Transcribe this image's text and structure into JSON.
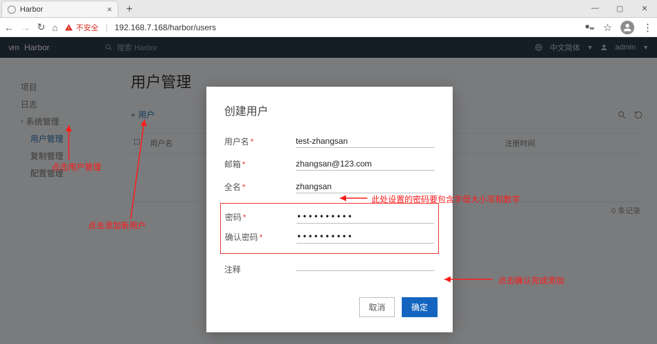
{
  "browser": {
    "tab_title": "Harbor",
    "ssl_warning": "不安全",
    "url": "192.168.7.168/harbor/users"
  },
  "harbor_header": {
    "vm_logo": "vm",
    "product": "Harbor",
    "search_placeholder": "搜索 Harbor",
    "lang": "中文简体",
    "user": "admin"
  },
  "sidebar": {
    "items": [
      {
        "label": "项目"
      },
      {
        "label": "日志"
      }
    ],
    "group_label": "系统管理",
    "sub_items": [
      {
        "label": "用户管理",
        "active": true
      },
      {
        "label": "复制管理"
      },
      {
        "label": "配置管理"
      }
    ]
  },
  "main": {
    "title": "用户管理",
    "add_button": "用户",
    "columns": {
      "c1": "用户名",
      "c2": "注册时间"
    },
    "footer": "0 条记录"
  },
  "modal": {
    "title": "创建用户",
    "labels": {
      "username": "用户名",
      "email": "邮箱",
      "fullname": "全名",
      "password": "密码",
      "confirm": "确认密码",
      "comment": "注释"
    },
    "values": {
      "username": "test-zhangsan",
      "email": "zhangsan@123.com",
      "fullname": "zhangsan",
      "password": "••••••••••",
      "confirm": "••••••••••",
      "comment": ""
    },
    "required_mark": "*",
    "buttons": {
      "cancel": "取消",
      "ok": "确定"
    }
  },
  "annotations": {
    "a1": "点击用户管理",
    "a2": "点击添加新用户",
    "a3": "此处设置的密码要包含字母大小写和数字",
    "a4": "点击确认完成添加"
  }
}
